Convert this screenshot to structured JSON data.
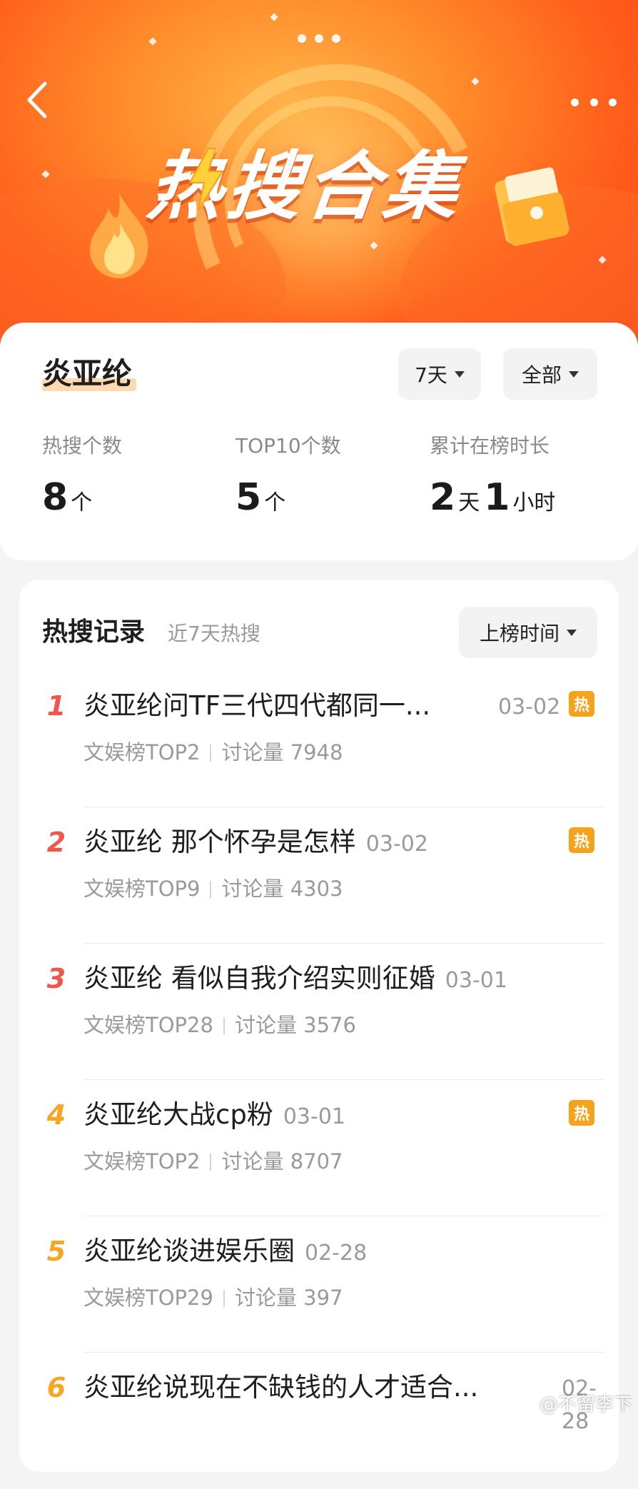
{
  "header": {
    "banner_title": "热搜合集"
  },
  "summary": {
    "name": "炎亚纶",
    "period_label": "7天",
    "scope_label": "全部",
    "stats": [
      {
        "label": "热搜个数",
        "value": "8",
        "unit": "个"
      },
      {
        "label": "TOP10个数",
        "value": "5",
        "unit": "个"
      },
      {
        "label": "累计在榜时长",
        "value_days": "2",
        "unit_days": "天",
        "value_hours": "1",
        "unit_hours": "小时"
      }
    ]
  },
  "records": {
    "title": "热搜记录",
    "subtitle": "近7天热搜",
    "sort_label": "上榜时间",
    "hot_badge": "热",
    "items": [
      {
        "rank": "1",
        "title": "炎亚纶问TF三代四代都同一...",
        "date": "03-02",
        "hot": true,
        "board": "文娱榜TOP2",
        "discussion": "讨论量 7948"
      },
      {
        "rank": "2",
        "title": "炎亚纶 那个怀孕是怎样",
        "date": "03-02",
        "hot": true,
        "board": "文娱榜TOP9",
        "discussion": "讨论量 4303"
      },
      {
        "rank": "3",
        "title": "炎亚纶 看似自我介绍实则征婚",
        "date": "03-01",
        "hot": false,
        "board": "文娱榜TOP28",
        "discussion": "讨论量 3576"
      },
      {
        "rank": "4",
        "title": "炎亚纶大战cp粉",
        "date": "03-01",
        "hot": true,
        "board": "文娱榜TOP2",
        "discussion": "讨论量 8707"
      },
      {
        "rank": "5",
        "title": "炎亚纶谈进娱乐圈",
        "date": "02-28",
        "hot": false,
        "board": "文娱榜TOP29",
        "discussion": "讨论量 397"
      },
      {
        "rank": "6",
        "title": "炎亚纶说现在不缺钱的人才适合...",
        "date": "02-28",
        "hot": false,
        "board": "",
        "discussion": ""
      }
    ]
  },
  "watermark": "@不留李下",
  "colors": {
    "accent_orange": "#ff6a24",
    "rank_top": "#f0574a",
    "rank_mid": "#f5a623",
    "hot_badge": "#f7a21b"
  }
}
